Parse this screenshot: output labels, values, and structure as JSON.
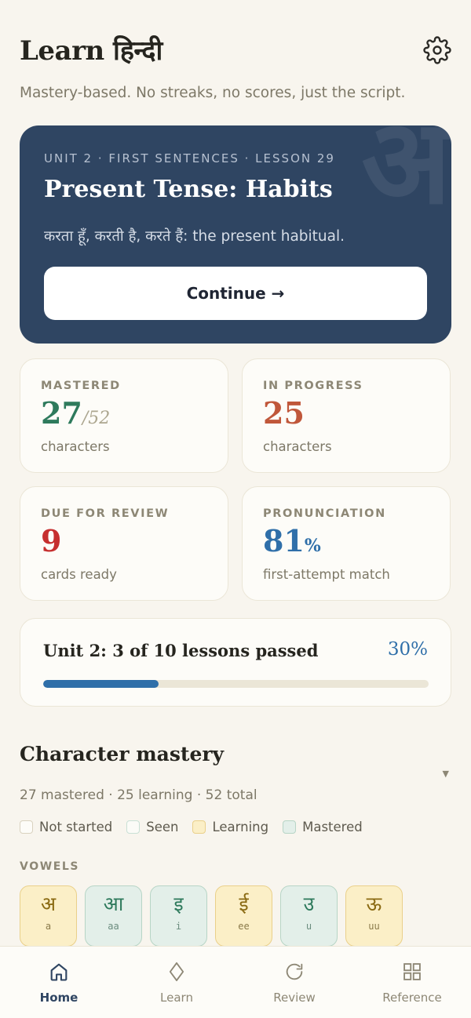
{
  "header": {
    "title": "Learn हिन्दी",
    "subtitle": "Mastery-based. No streaks, no scores, just the script."
  },
  "hero": {
    "watermark": "अ",
    "eyebrow": "UNIT 2 · FIRST SENTENCES · LESSON 29",
    "title": "Present Tense: Habits",
    "description": "करता हूँ, करती है, करते हैं: the present habitual.",
    "cta": "Continue →"
  },
  "stats": {
    "mastered": {
      "label": "MASTERED",
      "value": "27",
      "total": "/52",
      "caption": "characters",
      "color": "#2e7a5c"
    },
    "in_progress": {
      "label": "IN PROGRESS",
      "value": "25",
      "caption": "characters",
      "color": "#c0573a"
    },
    "due": {
      "label": "DUE FOR REVIEW",
      "value": "9",
      "caption": "cards ready",
      "color": "#c62f2f"
    },
    "pronunciation": {
      "label": "PRONUNCIATION",
      "value": "81",
      "unit": "%",
      "caption": "first-attempt match",
      "color": "#2f6fa9"
    }
  },
  "unit_progress": {
    "title": "Unit 2: 3 of 10 lessons passed",
    "percent_label": "30%",
    "fraction": 0.3
  },
  "mastery": {
    "title": "Character mastery",
    "summary": "27 mastered · 25 learning · 52 total",
    "legend": [
      {
        "label": "Not started",
        "bg": "#fdfcf8",
        "border": "#d9d2bf"
      },
      {
        "label": "Seen",
        "bg": "#fbfbf7",
        "border": "#c9e0d5"
      },
      {
        "label": "Learning",
        "bg": "#fbefc7",
        "border": "#ead08a"
      },
      {
        "label": "Mastered",
        "bg": "#e3efe9",
        "border": "#b7d5c6"
      }
    ],
    "group_label": "VOWELS",
    "vowels": [
      {
        "char": "अ",
        "roman": "a",
        "state": "learning"
      },
      {
        "char": "आ",
        "roman": "aa",
        "state": "mastered"
      },
      {
        "char": "इ",
        "roman": "i",
        "state": "mastered"
      },
      {
        "char": "ई",
        "roman": "ee",
        "state": "learning"
      },
      {
        "char": "उ",
        "roman": "u",
        "state": "mastered"
      },
      {
        "char": "ऊ",
        "roman": "uu",
        "state": "learning"
      }
    ]
  },
  "tabs": [
    {
      "label": "Home",
      "icon": "home-icon",
      "active": true
    },
    {
      "label": "Learn",
      "icon": "diamond-icon",
      "active": false
    },
    {
      "label": "Review",
      "icon": "refresh-icon",
      "active": false
    },
    {
      "label": "Reference",
      "icon": "grid-icon",
      "active": false
    }
  ]
}
